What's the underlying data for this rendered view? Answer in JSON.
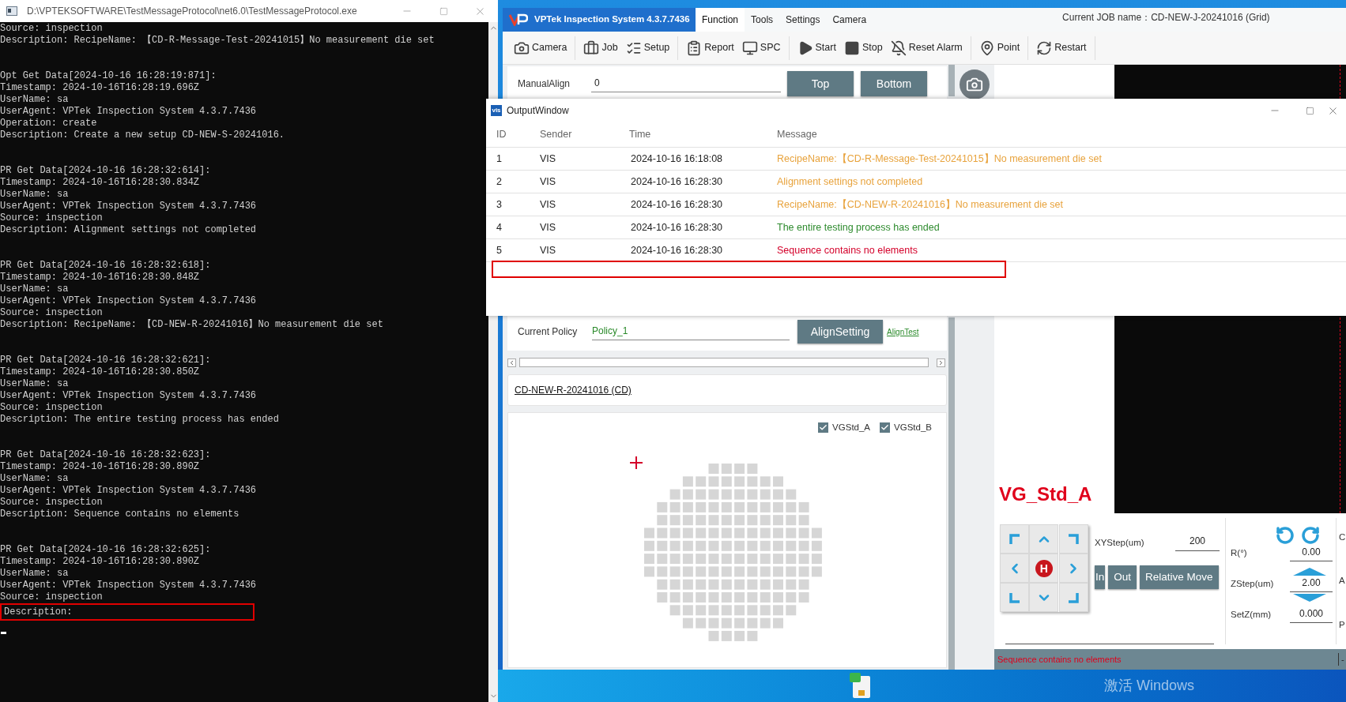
{
  "console": {
    "title": "D:\\VPTEKSOFTWARE\\TestMessageProtocol\\net6.0\\TestMessageProtocol.exe",
    "blocks": [
      {
        "lines": [
          "Source: inspection",
          "Description: RecipeName: 【CD-R-Message-Test-20241015】No measurement die set"
        ],
        "highlight_last": false
      },
      {
        "lines": [
          "Opt Get Data[2024-10-16 16:28:19:871]:",
          "Timestamp: 2024-10-16T16:28:19.696Z",
          "UserName: sa",
          "UserAgent: VPTek Inspection System 4.3.7.7436",
          "Operation: create",
          "Description: Create a new setup CD-NEW-S-20241016."
        ],
        "highlight_last": false
      },
      {
        "lines": [
          "PR Get Data[2024-10-16 16:28:32:614]:",
          "Timestamp: 2024-10-16T16:28:30.834Z",
          "UserName: sa",
          "UserAgent: VPTek Inspection System 4.3.7.7436",
          "Source: inspection",
          "Description: Alignment settings not completed"
        ],
        "highlight_last": false
      },
      {
        "lines": [
          "PR Get Data[2024-10-16 16:28:32:618]:",
          "Timestamp: 2024-10-16T16:28:30.848Z",
          "UserName: sa",
          "UserAgent: VPTek Inspection System 4.3.7.7436",
          "Source: inspection",
          "Description: RecipeName: 【CD-NEW-R-20241016】No measurement die set"
        ],
        "highlight_last": false
      },
      {
        "lines": [
          "PR Get Data[2024-10-16 16:28:32:621]:",
          "Timestamp: 2024-10-16T16:28:30.850Z",
          "UserName: sa",
          "UserAgent: VPTek Inspection System 4.3.7.7436",
          "Source: inspection",
          "Description: The entire testing process has ended"
        ],
        "highlight_last": false
      },
      {
        "lines": [
          "PR Get Data[2024-10-16 16:28:32:623]:",
          "Timestamp: 2024-10-16T16:28:30.890Z",
          "UserName: sa",
          "UserAgent: VPTek Inspection System 4.3.7.7436",
          "Source: inspection",
          "Description: Sequence contains no elements"
        ],
        "highlight_last": false
      },
      {
        "lines": [
          "PR Get Data[2024-10-16 16:28:32:625]:",
          "Timestamp: 2024-10-16T16:28:30.890Z",
          "UserName: sa",
          "UserAgent: VPTek Inspection System 4.3.7.7436",
          "Source: inspection",
          "Description:"
        ],
        "highlight_last": true
      }
    ]
  },
  "app": {
    "title": "VPTek Inspection System 4.3.7.7436",
    "menu": [
      {
        "label": "Function",
        "selected": true
      },
      {
        "label": "Tools",
        "selected": false
      },
      {
        "label": "Settings",
        "selected": false
      },
      {
        "label": "Camera",
        "selected": false
      }
    ],
    "job_name": "Current JOB name：CD-NEW-J-20241016 (Grid)",
    "toolbar_groups": [
      [
        "Camera"
      ],
      [
        "Job",
        "Setup"
      ],
      [
        "Report",
        "SPC"
      ],
      [
        "Start",
        "Stop",
        "Reset Alarm"
      ],
      [
        "Point"
      ],
      [
        "Restart"
      ]
    ],
    "manual_align": {
      "label": "ManualAlign",
      "value": "0",
      "buttons": [
        "Top",
        "Bottom"
      ]
    },
    "policy": {
      "label": "Current Policy",
      "value": "Policy_1",
      "button": "AlignSetting",
      "link": "AlignTest"
    },
    "recipe_link": "CD-NEW-R-20241016 (CD)",
    "layers": [
      {
        "label": "VGStd_A",
        "checked": true
      },
      {
        "label": "VGStd_B",
        "checked": true
      }
    ],
    "view_label": "VG_Std_A",
    "motion": {
      "home_label": "H",
      "xy_step_label": "XYStep(um)",
      "xy_step": "200",
      "buttons": [
        "In",
        "Out",
        "Relative Move"
      ],
      "fields": [
        {
          "label": "R(°)",
          "value": "0.00"
        },
        {
          "label": "ZStep(um)",
          "value": "2.00"
        },
        {
          "label": "SetZ(mm)",
          "value": "0.000"
        }
      ],
      "cut_labels": [
        "C",
        "A",
        "P"
      ]
    },
    "status_bar": {
      "message": "Sequence contains no elements",
      "right": "-"
    }
  },
  "output_window": {
    "icon_text": "vis",
    "title": "OutputWindow",
    "columns": [
      "ID",
      "Sender",
      "Time",
      "Message"
    ],
    "rows": [
      {
        "id": "1",
        "sender": "VIS",
        "time": "2024-10-16 16:18:08",
        "message": "RecipeName:【CD-R-Message-Test-20241015】No measurement die set",
        "color": "#e8a33d"
      },
      {
        "id": "2",
        "sender": "VIS",
        "time": "2024-10-16 16:28:30",
        "message": "Alignment settings not completed",
        "color": "#e8a33d"
      },
      {
        "id": "3",
        "sender": "VIS",
        "time": "2024-10-16 16:28:30",
        "message": "RecipeName:【CD-NEW-R-20241016】No measurement die set",
        "color": "#e8a33d"
      },
      {
        "id": "4",
        "sender": "VIS",
        "time": "2024-10-16 16:28:30",
        "message": "The entire testing process has ended",
        "color": "#2e8b2e"
      },
      {
        "id": "5",
        "sender": "VIS",
        "time": "2024-10-16 16:28:30",
        "message": "Sequence contains no elements",
        "color": "#d4002a"
      }
    ],
    "highlight_new_row": true
  },
  "taskbar": {
    "watermark": "激活 Windows"
  }
}
